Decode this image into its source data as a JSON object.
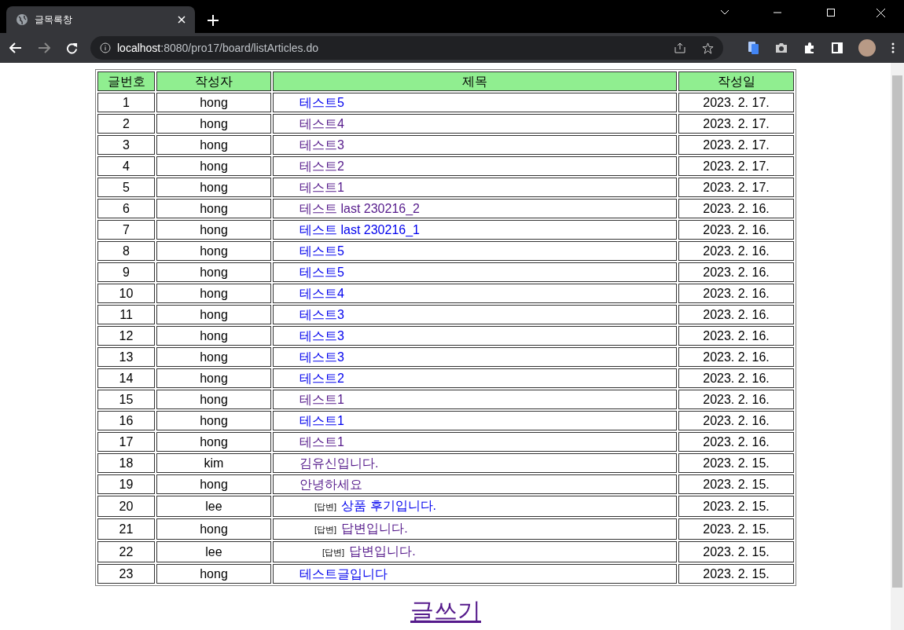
{
  "browser": {
    "tab_title": "글목록창",
    "address_host": "localhost",
    "address_rest": ":8080/pro17/board/listArticles.do"
  },
  "table": {
    "columns": [
      "글번호",
      "작성자",
      "제목",
      "작성일"
    ],
    "rows": [
      {
        "number": "1",
        "author": "hong",
        "title": "테스트5",
        "date": "2023. 2. 17.",
        "visited": false
      },
      {
        "number": "2",
        "author": "hong",
        "title": "테스트4",
        "date": "2023. 2. 17.",
        "visited": true
      },
      {
        "number": "3",
        "author": "hong",
        "title": "테스트3",
        "date": "2023. 2. 17.",
        "visited": true
      },
      {
        "number": "4",
        "author": "hong",
        "title": "테스트2",
        "date": "2023. 2. 17.",
        "visited": true
      },
      {
        "number": "5",
        "author": "hong",
        "title": "테스트1",
        "date": "2023. 2. 17.",
        "visited": true
      },
      {
        "number": "6",
        "author": "hong",
        "title": "테스트 last 230216_2",
        "date": "2023. 2. 16.",
        "visited": true
      },
      {
        "number": "7",
        "author": "hong",
        "title": "테스트 last 230216_1",
        "date": "2023. 2. 16.",
        "visited": false
      },
      {
        "number": "8",
        "author": "hong",
        "title": "테스트5",
        "date": "2023. 2. 16.",
        "visited": false
      },
      {
        "number": "9",
        "author": "hong",
        "title": "테스트5",
        "date": "2023. 2. 16.",
        "visited": false
      },
      {
        "number": "10",
        "author": "hong",
        "title": "테스트4",
        "date": "2023. 2. 16.",
        "visited": false
      },
      {
        "number": "11",
        "author": "hong",
        "title": "테스트3",
        "date": "2023. 2. 16.",
        "visited": false
      },
      {
        "number": "12",
        "author": "hong",
        "title": "테스트3",
        "date": "2023. 2. 16.",
        "visited": false
      },
      {
        "number": "13",
        "author": "hong",
        "title": "테스트3",
        "date": "2023. 2. 16.",
        "visited": false
      },
      {
        "number": "14",
        "author": "hong",
        "title": "테스트2",
        "date": "2023. 2. 16.",
        "visited": false
      },
      {
        "number": "15",
        "author": "hong",
        "title": "테스트1",
        "date": "2023. 2. 16.",
        "visited": true
      },
      {
        "number": "16",
        "author": "hong",
        "title": "테스트1",
        "date": "2023. 2. 16.",
        "visited": false
      },
      {
        "number": "17",
        "author": "hong",
        "title": "테스트1",
        "date": "2023. 2. 16.",
        "visited": true
      },
      {
        "number": "18",
        "author": "kim",
        "title": "김유신입니다.",
        "date": "2023. 2. 15.",
        "visited": true
      },
      {
        "number": "19",
        "author": "hong",
        "title": "안녕하세요",
        "date": "2023. 2. 15.",
        "visited": true,
        "children": [
          {
            "number": "20",
            "author": "lee",
            "reply_tag": "[답변]",
            "title": "상품 후기입니다.",
            "date": "2023. 2. 15.",
            "visited": false
          },
          {
            "number": "21",
            "author": "hong",
            "reply_tag": "[답변]",
            "title": "답변입니다.",
            "date": "2023. 2. 15.",
            "visited": true,
            "children": [
              {
                "number": "22",
                "author": "lee",
                "reply_tag": "[답변]",
                "title": "답변입니다.",
                "date": "2023. 2. 15.",
                "visited": true
              }
            ]
          }
        ]
      },
      {
        "number": "23",
        "author": "hong",
        "title": "테스트글입니다",
        "date": "2023. 2. 15.",
        "visited": false
      }
    ]
  },
  "write_link": "글쓰기"
}
